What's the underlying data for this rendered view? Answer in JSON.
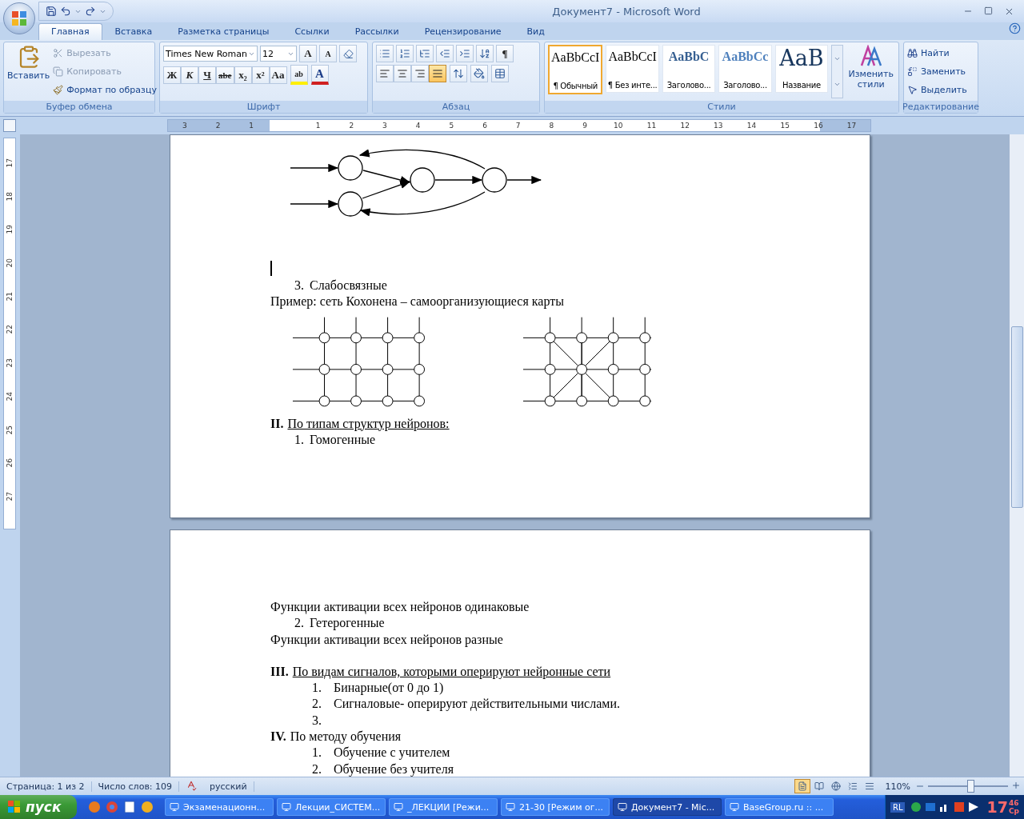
{
  "window": {
    "title": "Документ7 - Microsoft Word"
  },
  "tabs": [
    {
      "label": "Главная",
      "selected": true
    },
    {
      "label": "Вставка",
      "selected": false
    },
    {
      "label": "Разметка страницы",
      "selected": false
    },
    {
      "label": "Ссылки",
      "selected": false
    },
    {
      "label": "Рассылки",
      "selected": false
    },
    {
      "label": "Рецензирование",
      "selected": false
    },
    {
      "label": "Вид",
      "selected": false
    }
  ],
  "clipboard": {
    "paste": "Вставить",
    "cut": "Вырезать",
    "copy": "Копировать",
    "format_painter": "Формат по образцу",
    "group": "Буфер обмена"
  },
  "font": {
    "name": "Times New Roman",
    "size": "12",
    "grow": "A",
    "shrink": "A",
    "format_buttons": [
      "Ж",
      "К",
      "Ч",
      "abe",
      "x₂",
      "x²",
      "Aa"
    ],
    "highlight": "ab",
    "font_color_key": "A",
    "group": "Шрифт"
  },
  "paragraph": {
    "pilcrow": "¶",
    "align": [
      {
        "kind": "left",
        "selected": false
      },
      {
        "kind": "center",
        "selected": false
      },
      {
        "kind": "right",
        "selected": false
      },
      {
        "kind": "justify",
        "selected": true
      }
    ],
    "group": "Абзац"
  },
  "styles": {
    "items": [
      {
        "preview": "AaBbCcI",
        "label": "¶ Обычный",
        "kind": "normal",
        "selected": true
      },
      {
        "preview": "AaBbCcI",
        "label": "¶ Без инте...",
        "kind": "normal",
        "selected": false
      },
      {
        "preview": "AaBbC",
        "label": "Заголово...",
        "kind": "heading1",
        "selected": false
      },
      {
        "preview": "AaBbCc",
        "label": "Заголово...",
        "kind": "heading2",
        "selected": false
      },
      {
        "preview": "AaB",
        "label": "Название",
        "kind": "title",
        "selected": false
      }
    ],
    "change": "Изменить стили",
    "group": "Стили"
  },
  "editing": {
    "find": "Найти",
    "replace": "Заменить",
    "select": "Выделить",
    "group": "Редактирование"
  },
  "ruler": {
    "left_ticks": [
      "3",
      "2",
      "1"
    ],
    "right_ticks": [
      "1",
      "2",
      "3",
      "4",
      "5",
      "6",
      "7",
      "8",
      "9",
      "10",
      "11",
      "12",
      "13",
      "14",
      "15",
      "16",
      "17"
    ],
    "v_ticks": [
      "17",
      "18",
      "19",
      "20",
      "21",
      "22",
      "23",
      "24",
      "25",
      "26",
      "27"
    ]
  },
  "page1": [
    {
      "kind": "feedback_drawing"
    },
    {
      "kind": "cursor"
    },
    {
      "kind": "item",
      "number": "3.",
      "text": "Слабосвязные",
      "wide": false
    },
    {
      "kind": "para",
      "text": "Пример: сеть Кохонена – самоорганизующиеся карты"
    },
    {
      "kind": "grid_drawing"
    },
    {
      "kind": "heading",
      "numeral": "II.",
      "text": "По типам структур нейронов:",
      "underlined": true
    },
    {
      "kind": "item",
      "number": "1.",
      "text": "Гомогенные",
      "wide": false
    }
  ],
  "page2": [
    {
      "kind": "para",
      "text": "Функции активации всех нейронов одинаковые"
    },
    {
      "kind": "item",
      "number": "2.",
      "text": "Гетерогенные",
      "wide": false
    },
    {
      "kind": "para",
      "text": "Функции активации всех нейронов разные"
    },
    {
      "kind": "blank"
    },
    {
      "kind": "heading",
      "numeral": "III.",
      "text": "По видам сигналов, которыми оперируют нейронные сети",
      "underlined": true
    },
    {
      "kind": "item",
      "number": "1.",
      "text": "Бинарные(от 0 до 1)",
      "wide": true
    },
    {
      "kind": "item",
      "number": "2.",
      "text": "Сигналовые- оперируют действительными числами.",
      "wide": true
    },
    {
      "kind": "item",
      "number": "3.",
      "wide": true
    },
    {
      "kind": "heading",
      "numeral": "IV.",
      "text": "По методу обучения",
      "underlined": false
    },
    {
      "kind": "item",
      "number": "1.",
      "text": "Обучение с учителем",
      "wide": true
    },
    {
      "kind": "item",
      "number": "2.",
      "text": "Обучение без учителя",
      "wide": true
    }
  ],
  "status": {
    "page": "Страница: 1 из 2",
    "words": "Число слов: 109",
    "language": "русский",
    "views": [
      {
        "kind": "print",
        "selected": true
      },
      {
        "kind": "reading",
        "selected": false
      },
      {
        "kind": "web",
        "selected": false
      },
      {
        "kind": "outline",
        "selected": false
      },
      {
        "kind": "draft",
        "selected": false
      }
    ],
    "zoom": "110%",
    "zoom_slider": {
      "level": 0.52
    }
  },
  "taskbar": {
    "start": "пуск",
    "tasks": [
      {
        "label": "Экзаменационн...",
        "selected": false
      },
      {
        "label": "Лекции_СИСТЕМ...",
        "selected": false
      },
      {
        "label": "_ЛЕКЦИИ [Режи...",
        "selected": false
      },
      {
        "label": "21-30 [Режим ог...",
        "selected": false
      },
      {
        "label": "Документ7 - Mic...",
        "selected": true
      },
      {
        "label": "BaseGroup.ru :: ...",
        "selected": false
      }
    ],
    "lang": "RL",
    "hour": "17",
    "minute": "46",
    "day": "Ср"
  }
}
